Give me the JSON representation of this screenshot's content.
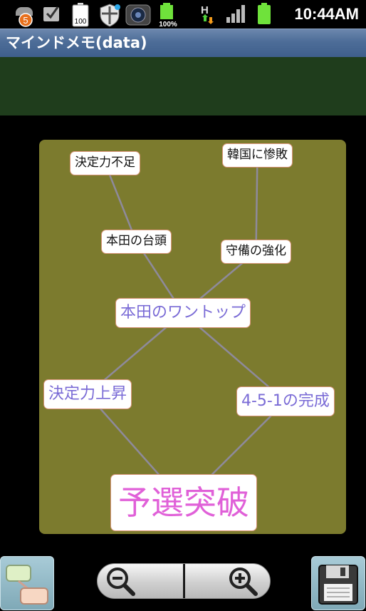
{
  "status_bar": {
    "time": "10:44AM",
    "notification_count": "5",
    "battery_level_1": "100",
    "battery_level_2": "100%",
    "network_type": "H",
    "icons": [
      "notification-badge-icon",
      "checkbox-icon",
      "battery-widget-icon",
      "shield-icon",
      "camera-icon",
      "battery-percent-icon",
      "data-transfer-icon",
      "signal-icon",
      "battery-icon"
    ]
  },
  "app": {
    "title": "マインドメモ(data)"
  },
  "mindmap": {
    "nodes": [
      {
        "id": "kettei-fusoku",
        "label": "決定力不足",
        "size": "small"
      },
      {
        "id": "kankoku",
        "label": "韓国に惨敗",
        "size": "small"
      },
      {
        "id": "honda-taito",
        "label": "本田の台頭",
        "size": "small"
      },
      {
        "id": "shubi",
        "label": "守備の強化",
        "size": "small"
      },
      {
        "id": "honda-wantop",
        "label": "本田のワントップ",
        "size": "medium"
      },
      {
        "id": "kettei-joushou",
        "label": "決定力上昇",
        "size": "medium"
      },
      {
        "id": "451",
        "label": "4-5-1の完成",
        "size": "medium"
      },
      {
        "id": "yosen",
        "label": "予選突破",
        "size": "large"
      }
    ],
    "links": [
      [
        "kettei-fusoku",
        "honda-taito"
      ],
      [
        "kankoku",
        "shubi"
      ],
      [
        "honda-taito",
        "honda-wantop"
      ],
      [
        "shubi",
        "honda-wantop"
      ],
      [
        "honda-wantop",
        "kettei-joushou"
      ],
      [
        "honda-wantop",
        "451"
      ],
      [
        "kettei-joushou",
        "yosen"
      ],
      [
        "451",
        "yosen"
      ]
    ],
    "colors": {
      "canvas": "#7c7b2e",
      "link": "#8e8a9c",
      "small_text": "#111111",
      "medium_text": "#7a6bd6",
      "large_text": "#e060d8",
      "node_border": "#d89477"
    }
  },
  "toolbar": {
    "map_button_icon": "mindmap-nodes-icon",
    "zoom_out_icon": "zoom-out-icon",
    "zoom_in_icon": "zoom-in-icon",
    "save_button_icon": "floppy-disk-icon"
  }
}
